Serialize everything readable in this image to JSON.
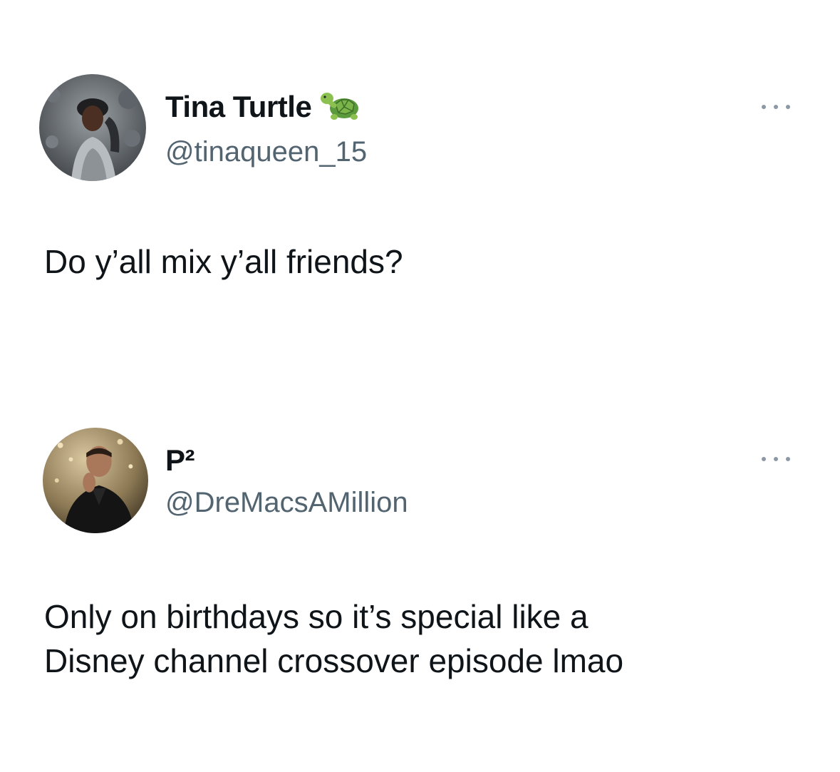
{
  "tweets": [
    {
      "display_name": "Tina Turtle",
      "name_emoji": "turtle-emoji",
      "handle": "@tinaqueen_15",
      "text": "Do y’all mix y’all friends?",
      "more_icon": "ellipsis-icon"
    },
    {
      "display_name": "P²",
      "handle": "@DreMacsAMillion",
      "text": "Only on birthdays so it’s special like a\nDisney channel crossover episode lmao",
      "more_icon": "ellipsis-icon"
    }
  ],
  "colors": {
    "text_primary": "#0f1419",
    "text_secondary": "#536471",
    "icon_muted": "#8b98a5",
    "background": "#ffffff"
  }
}
